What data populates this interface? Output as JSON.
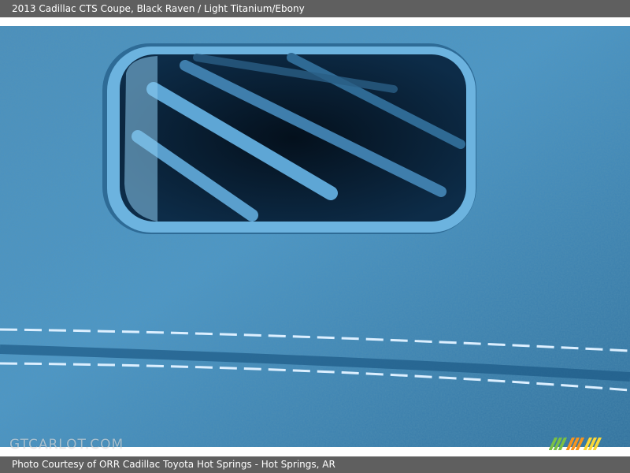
{
  "header": {
    "title": "2013 Cadillac CTS Coupe,  Black Raven / Light Titanium/Ebony"
  },
  "photo": {
    "subject": "air-vent-and-stitched-leather-dashboard",
    "watermark": "GTCARLOT.COM",
    "colors": {
      "leather": "#3f86b6",
      "stitching": "#d9ecf7",
      "vent_frame": "#5aa2d1"
    }
  },
  "footer": {
    "credit": "Photo Courtesy of ORR Cadillac Toyota Hot Springs - Hot Springs, AR"
  },
  "logo": {
    "colors": [
      "#7bc043",
      "#f7941d",
      "#fdd835"
    ]
  }
}
